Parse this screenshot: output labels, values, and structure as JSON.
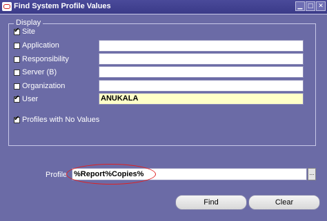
{
  "window": {
    "title": "Find System Profile Values",
    "controls": [
      "minimize",
      "maximize",
      "close"
    ]
  },
  "display": {
    "legend": "Display",
    "options": [
      {
        "label": "Site",
        "checked": true,
        "has_field": false
      },
      {
        "label": "Application",
        "checked": false,
        "value": ""
      },
      {
        "label": "Responsibility",
        "checked": false,
        "value": ""
      },
      {
        "label": "Server (B)",
        "checked": false,
        "value": ""
      },
      {
        "label": "Organization",
        "checked": false,
        "value": ""
      },
      {
        "label": "User",
        "checked": true,
        "value": "ANUKALA"
      },
      {
        "label": "Profiles with No Values",
        "checked": true,
        "has_field": false
      }
    ]
  },
  "profile": {
    "label": "Profile",
    "value": "%Report%Copies%",
    "lov_button": "..."
  },
  "buttons": {
    "find": "Find",
    "clear": "Clear"
  },
  "colors": {
    "background": "#6b6ba6",
    "titlebar": "#3a3a88",
    "required_field": "#ffffc8",
    "highlight": "#e02020"
  }
}
